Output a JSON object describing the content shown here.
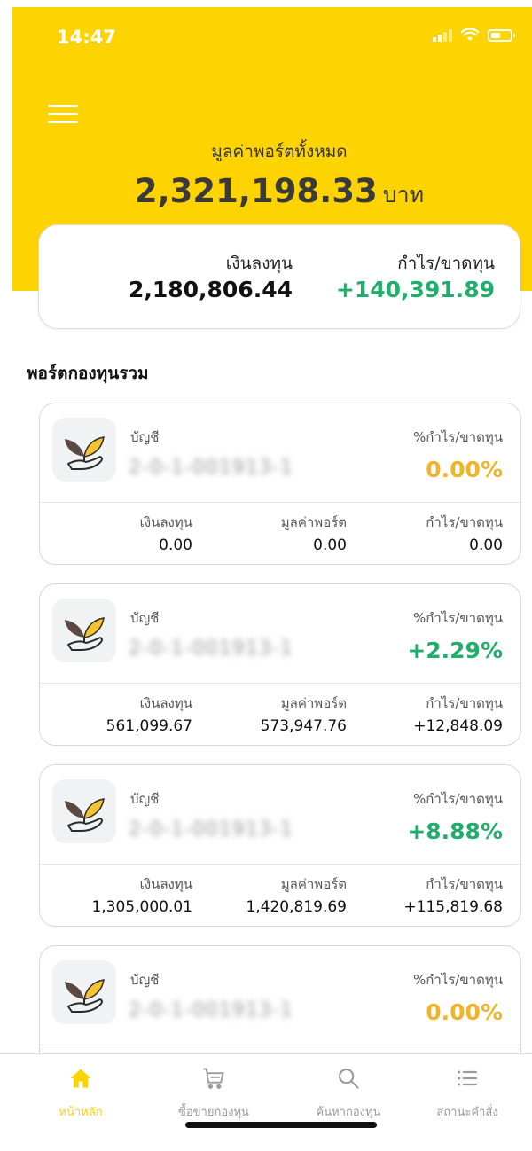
{
  "status_bar": {
    "time": "14:47"
  },
  "header": {
    "total_label": "มูลค่าพอร์ตทั้งหมด",
    "total_value": "2,321,198.33",
    "total_unit": "บาท"
  },
  "summary": {
    "investment_label": "เงินลงทุน",
    "investment_value": "2,180,806.44",
    "profit_label": "กำไร/ขาดทุน",
    "profit_value": "+140,391.89"
  },
  "section_title": "พอร์ตกองทุนรวม",
  "accounts": [
    {
      "account_label": "บัญชี",
      "account_number": "2-0-1-001913-1",
      "pct_label": "%กำไร/ขาดทุน",
      "pct_value": "0.00%",
      "invest_label": "เงินลงทุน",
      "invest_value": "0.00",
      "port_label": "มูลค่าพอร์ต",
      "port_value": "0.00",
      "pl_label": "กำไร/ขาดทุน",
      "pl_value": "0.00"
    },
    {
      "account_label": "บัญชี",
      "account_number": "2-0-1-001913-1",
      "pct_label": "%กำไร/ขาดทุน",
      "pct_value": "+2.29%",
      "invest_label": "เงินลงทุน",
      "invest_value": "561,099.67",
      "port_label": "มูลค่าพอร์ต",
      "port_value": "573,947.76",
      "pl_label": "กำไร/ขาดทุน",
      "pl_value": "+12,848.09"
    },
    {
      "account_label": "บัญชี",
      "account_number": "2-0-1-001913-1",
      "pct_label": "%กำไร/ขาดทุน",
      "pct_value": "+8.88%",
      "invest_label": "เงินลงทุน",
      "invest_value": "1,305,000.01",
      "port_label": "มูลค่าพอร์ต",
      "port_value": "1,420,819.69",
      "pl_label": "กำไร/ขาดทุน",
      "pl_value": "+115,819.68"
    },
    {
      "account_label": "บัญชี",
      "account_number": "2-0-1-001913-1",
      "pct_label": "%กำไร/ขาดทุน",
      "pct_value": "0.00%"
    }
  ],
  "tabs": [
    {
      "label": "หน้าหลัก",
      "icon": "home-icon",
      "active": true
    },
    {
      "label": "ซื้อขายกองทุน",
      "icon": "cart-icon",
      "active": false
    },
    {
      "label": "ค้นหากองทุน",
      "icon": "search-icon",
      "active": false
    },
    {
      "label": "สถานะคำสั่ง",
      "icon": "list-icon",
      "active": false
    }
  ],
  "colors": {
    "brand_yellow": "#fed302",
    "profit_green": "#21ae6b",
    "neutral_yellow": "#f0b429"
  }
}
